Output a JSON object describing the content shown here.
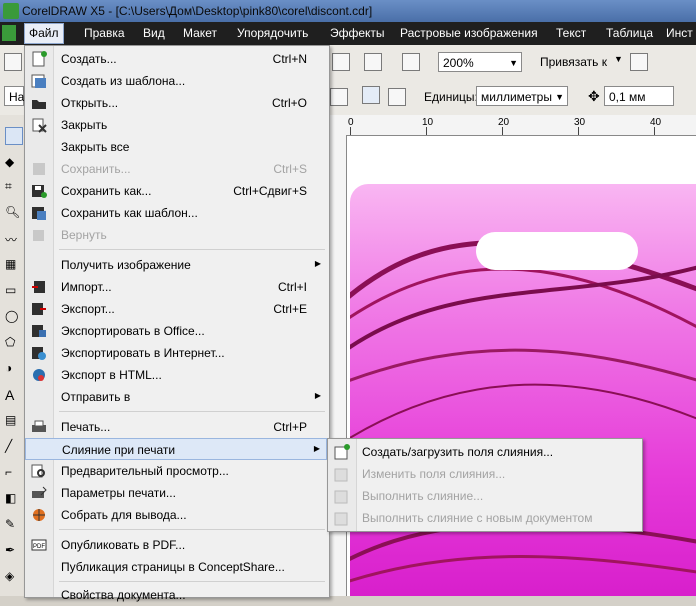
{
  "window": {
    "title": "CorelDRAW X5 - [C:\\Users\\Дом\\Desktop\\pink80\\corel\\discont.cdr]"
  },
  "menubar": {
    "items": [
      "Файл",
      "Правка",
      "Вид",
      "Макет",
      "Упорядочить",
      "Эффекты",
      "Растровые изображения",
      "Текст",
      "Таблица",
      "Инст"
    ]
  },
  "toolbar": {
    "zoom": "200%",
    "snap_label": "Привязать к",
    "preset_label": "На",
    "units_label": "Единицы:",
    "units_value": "миллиметры",
    "nudge_value": "0,1 мм"
  },
  "ruler": {
    "labels": [
      "0",
      "10",
      "20",
      "30",
      "40"
    ]
  },
  "file_menu": {
    "items": [
      {
        "label": "Создать...",
        "shortcut": "Ctrl+N",
        "icon": "new-doc-icon",
        "disabled": false
      },
      {
        "label": "Создать из шаблона...",
        "shortcut": "",
        "icon": "template-icon",
        "disabled": false
      },
      {
        "label": "Открыть...",
        "shortcut": "Ctrl+O",
        "icon": "open-folder-icon",
        "disabled": false
      },
      {
        "label": "Закрыть",
        "shortcut": "",
        "icon": "close-doc-icon",
        "disabled": false
      },
      {
        "label": "Закрыть все",
        "shortcut": "",
        "icon": "",
        "disabled": false
      },
      {
        "label": "Сохранить...",
        "shortcut": "Ctrl+S",
        "icon": "save-icon",
        "disabled": true
      },
      {
        "label": "Сохранить как...",
        "shortcut": "Ctrl+Сдвиг+S",
        "icon": "save-as-icon",
        "disabled": false
      },
      {
        "label": "Сохранить как шаблон...",
        "shortcut": "",
        "icon": "save-template-icon",
        "disabled": false
      },
      {
        "label": "Вернуть",
        "shortcut": "",
        "icon": "revert-icon",
        "disabled": true
      },
      {
        "label": "Получить изображение",
        "shortcut": "",
        "icon": "",
        "disabled": false,
        "submenu": true
      },
      {
        "label": "Импорт...",
        "shortcut": "Ctrl+I",
        "icon": "import-icon",
        "disabled": false
      },
      {
        "label": "Экспорт...",
        "shortcut": "Ctrl+E",
        "icon": "export-icon",
        "disabled": false
      },
      {
        "label": "Экспортировать в Office...",
        "shortcut": "",
        "icon": "export-office-icon",
        "disabled": false
      },
      {
        "label": "Экспортировать в Интернет...",
        "shortcut": "",
        "icon": "export-web-icon",
        "disabled": false
      },
      {
        "label": "Экспорт в HTML...",
        "shortcut": "",
        "icon": "export-html-icon",
        "disabled": false
      },
      {
        "label": "Отправить в",
        "shortcut": "",
        "icon": "",
        "disabled": false,
        "submenu": true
      },
      {
        "label": "Печать...",
        "shortcut": "Ctrl+P",
        "icon": "print-icon",
        "disabled": false
      },
      {
        "label": "Слияние при печати",
        "shortcut": "",
        "icon": "",
        "disabled": false,
        "submenu": true,
        "highlighted": true
      },
      {
        "label": "Предварительный просмотр...",
        "shortcut": "",
        "icon": "print-preview-icon",
        "disabled": false
      },
      {
        "label": "Параметры печати...",
        "shortcut": "",
        "icon": "print-settings-icon",
        "disabled": false
      },
      {
        "label": "Собрать для вывода...",
        "shortcut": "",
        "icon": "collect-output-icon",
        "disabled": false
      },
      {
        "label": "Опубликовать в PDF...",
        "shortcut": "",
        "icon": "pdf-icon",
        "disabled": false
      },
      {
        "label": "Публикация страницы в ConceptShare...",
        "shortcut": "",
        "icon": "",
        "disabled": false
      },
      {
        "label": "Свойства документа...",
        "shortcut": "",
        "icon": "",
        "disabled": false
      }
    ]
  },
  "merge_submenu": {
    "items": [
      {
        "label": "Создать/загрузить поля слияния...",
        "disabled": false
      },
      {
        "label": "Изменить поля слияния...",
        "disabled": true
      },
      {
        "label": "Выполнить слияние...",
        "disabled": true
      },
      {
        "label": "Выполнить слияние с новым документом",
        "disabled": true
      }
    ]
  }
}
